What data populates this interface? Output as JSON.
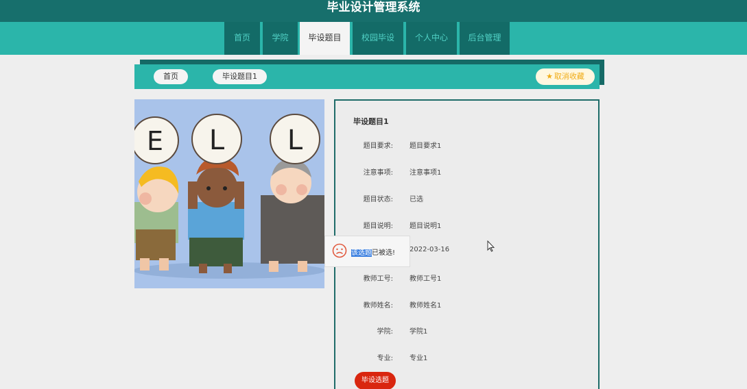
{
  "site": {
    "title": "毕业设计管理系统"
  },
  "nav": [
    {
      "label": "首页"
    },
    {
      "label": "学院"
    },
    {
      "label": "毕设题目"
    },
    {
      "label": "校园毕设"
    },
    {
      "label": "个人中心"
    },
    {
      "label": "后台管理"
    }
  ],
  "breadcrumb": {
    "home": "首页",
    "current": "毕设题目1"
  },
  "favorite": {
    "label": "取消收藏",
    "icon": "star-icon"
  },
  "image": {
    "letters": [
      "E",
      "L",
      "L"
    ]
  },
  "detail": {
    "title": "毕设题目1",
    "rows": [
      {
        "label": "题目要求:",
        "value": "题目要求1"
      },
      {
        "label": "注意事项:",
        "value": "注意事项1"
      },
      {
        "label": "题目状态:",
        "value": "已选"
      },
      {
        "label": "题目说明:",
        "value": "题目说明1"
      },
      {
        "label": "",
        "value": "2022-03-16"
      },
      {
        "label": "教师工号:",
        "value": "教师工号1"
      },
      {
        "label": "教师姓名:",
        "value": "教师姓名1"
      },
      {
        "label": "学院:",
        "value": "学院1"
      },
      {
        "label": "专业:",
        "value": "专业1"
      }
    ],
    "select_button": "毕设选题"
  },
  "toast": {
    "highlighted": "该选题",
    "rest": "已被选!",
    "icon": "sad-face-icon"
  },
  "colors": {
    "dark_teal": "#176f6c",
    "teal": "#2bb5aa",
    "danger": "#d9260f",
    "star": "#f0ac18"
  }
}
